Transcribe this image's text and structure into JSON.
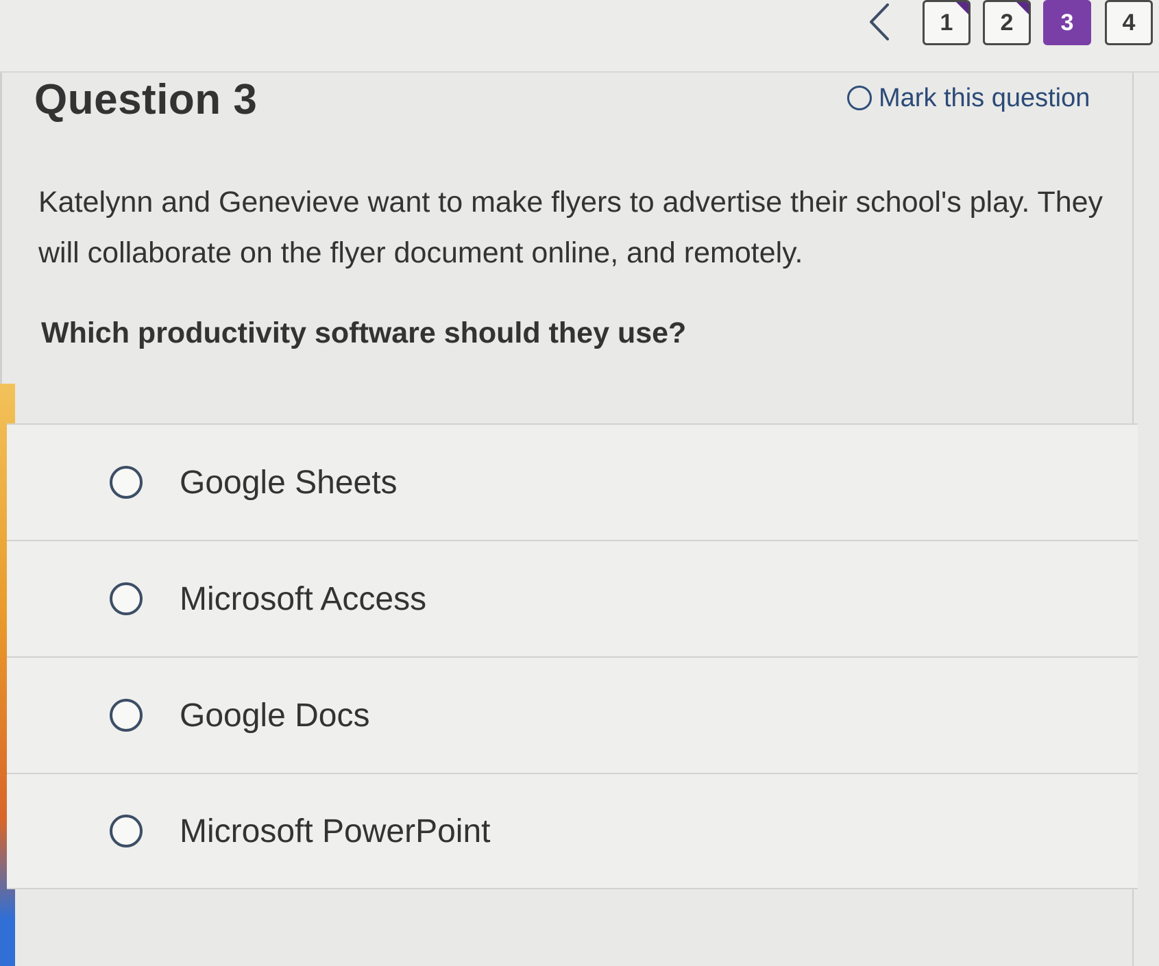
{
  "nav": {
    "prev_icon": "chevron-left-icon",
    "pages": [
      {
        "label": "1",
        "state": "visited"
      },
      {
        "label": "2",
        "state": "visited"
      },
      {
        "label": "3",
        "state": "current"
      },
      {
        "label": "4",
        "state": "default"
      }
    ]
  },
  "question": {
    "title": "Question 3",
    "mark_label": "Mark this question",
    "prompt": "Katelynn and Genevieve want to make flyers to advertise their school's play. They will collaborate on the flyer document online, and remotely.",
    "sub_question": "Which productivity software should they use?",
    "options": [
      {
        "label": "Google Sheets"
      },
      {
        "label": "Microsoft Access"
      },
      {
        "label": "Google Docs"
      },
      {
        "label": "Microsoft PowerPoint"
      }
    ]
  },
  "colors": {
    "accent_purple": "#7a3fa6",
    "link_blue": "#2b4a78"
  }
}
